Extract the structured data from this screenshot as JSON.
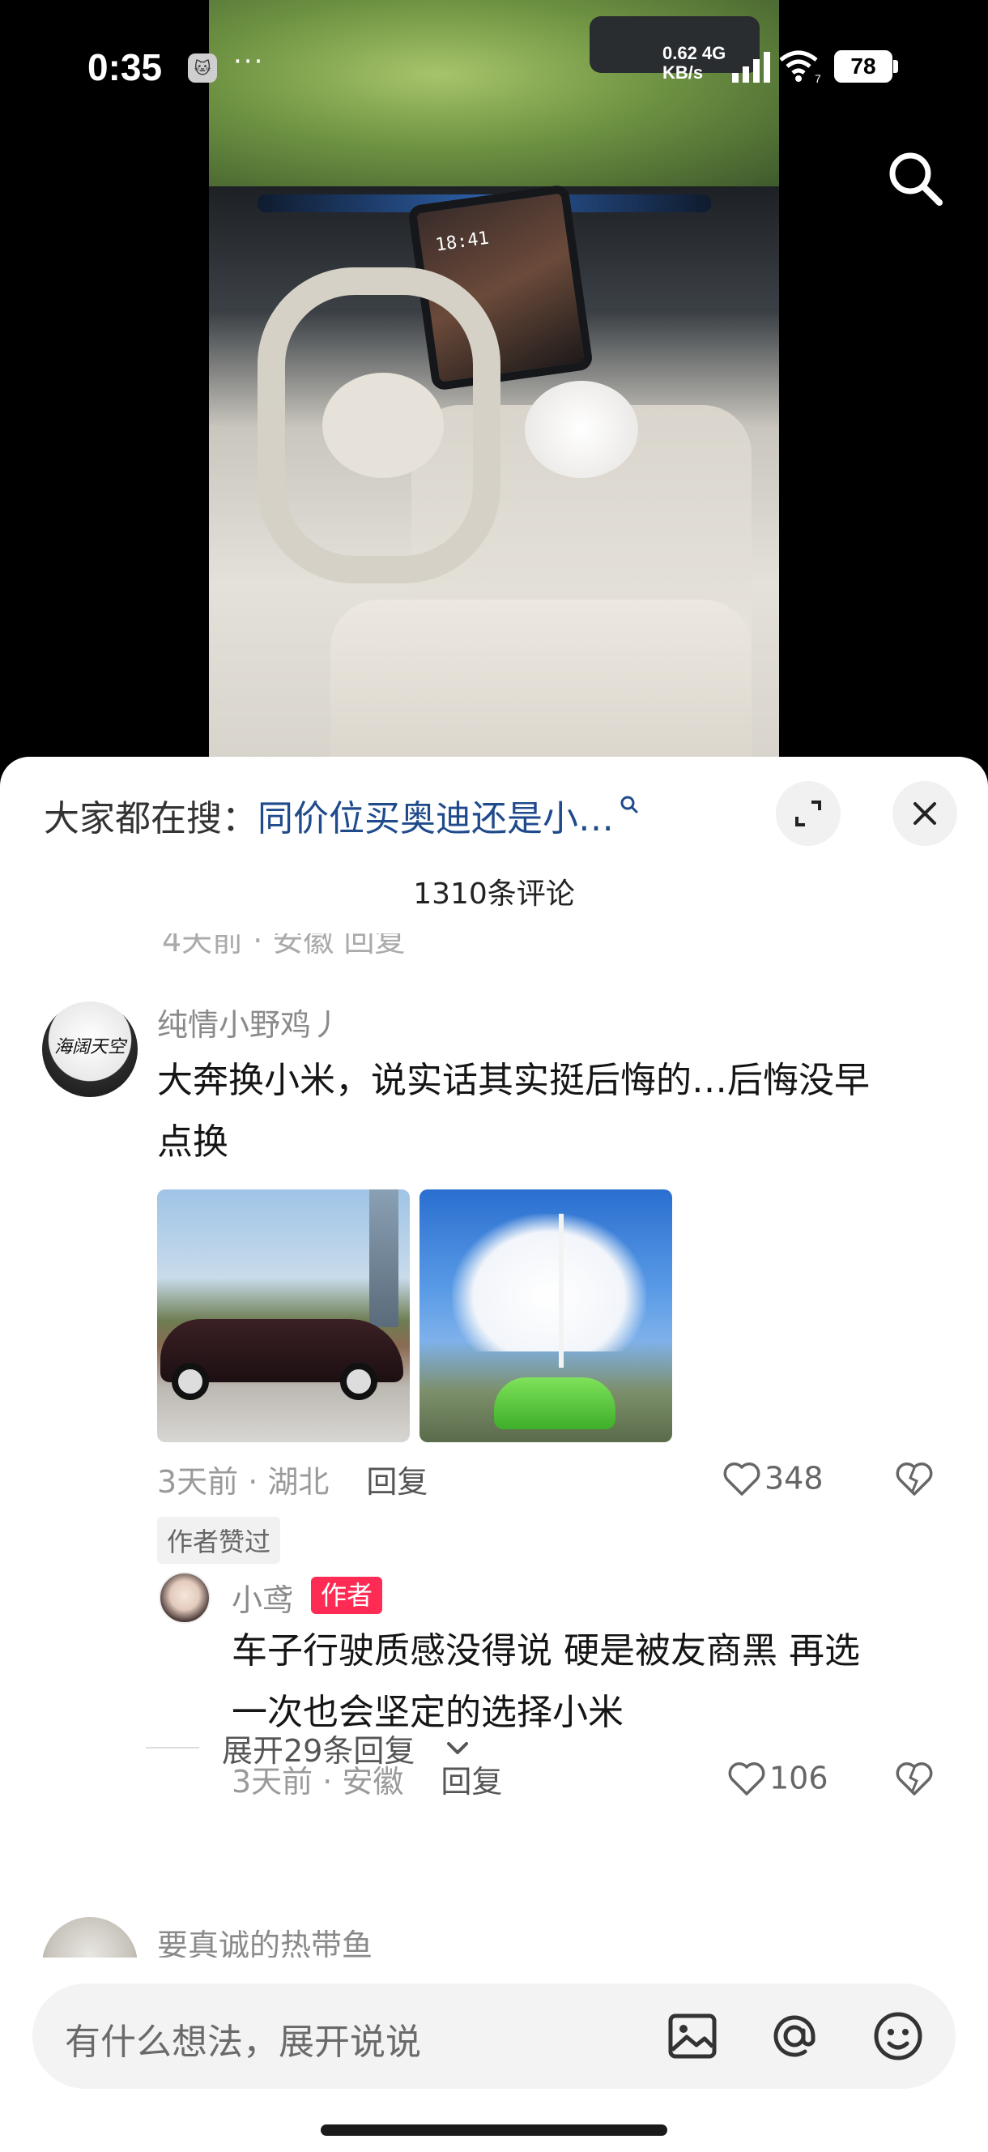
{
  "status_bar": {
    "time": "0:35",
    "app_icon_glyph": "🐱",
    "dots": "···",
    "net_speed_line1": "0.62 4G",
    "net_speed_line2": "KB/s",
    "wifi_badge": "7",
    "battery": "78"
  },
  "video": {
    "screen_time": "18:41"
  },
  "sheet": {
    "search_prefix": "大家都在搜：",
    "search_query": "同价位买奥迪还是小…",
    "comment_count": "1310条评论",
    "cutoff_text": "4天前 · 安徽      回复"
  },
  "comment_main": {
    "avatar_text": "海阔天空",
    "username": "纯情小野鸡丿",
    "text_line1": "大奔换小米，说实话其实挺后悔的…后悔没早",
    "text_line2": "点换",
    "time_location": "3天前 · 湖北",
    "reply_label": "回复",
    "like_count": "348",
    "author_liked": "作者赞过"
  },
  "comment_reply": {
    "username": "小鸢",
    "badge": "作者",
    "text_line1": "车子行驶质感没得说 硬是被友商黑 再选",
    "text_line2": "一次也会坚定的选择小米",
    "time_location": "3天前 · 安徽",
    "reply_label": "回复",
    "like_count": "106"
  },
  "expand_replies": {
    "label": "展开29条回复"
  },
  "comment_next": {
    "username": "要真诚的热带鱼"
  },
  "input": {
    "placeholder": "有什么想法，展开说说"
  },
  "colors": {
    "accent_red": "#fe2c55",
    "link_blue": "#1f4a8c"
  },
  "icons": {
    "search": "search-icon",
    "expand": "expand-icon",
    "close": "close-icon",
    "like": "heart-icon",
    "dislike": "broken-heart-icon",
    "image": "image-icon",
    "mention": "at-icon",
    "emoji": "emoji-icon",
    "chevron": "chevron-down-icon"
  }
}
